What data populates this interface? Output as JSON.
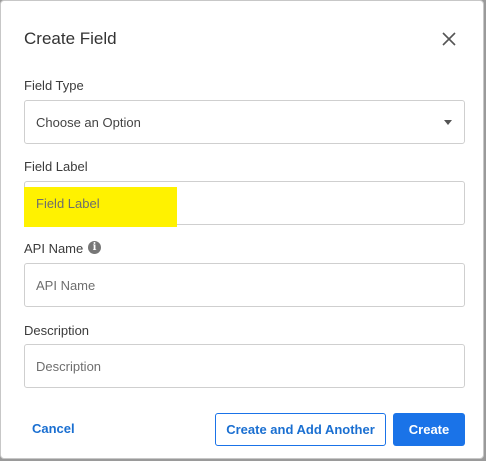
{
  "dialog": {
    "title": "Create Field",
    "close_icon": "close-icon"
  },
  "fields": {
    "field_type": {
      "label": "Field Type",
      "selected": "Choose an Option"
    },
    "field_label": {
      "label": "Field Label",
      "placeholder": "Field Label",
      "highlight_color": "#fff200"
    },
    "api_name": {
      "label": "API Name",
      "placeholder": "API Name",
      "info_icon": "info-icon"
    },
    "description": {
      "label": "Description",
      "placeholder": "Description"
    }
  },
  "footer": {
    "cancel_label": "Cancel",
    "create_another_label": "Create and Add Another",
    "create_label": "Create"
  },
  "colors": {
    "accent": "#1a73e8"
  }
}
